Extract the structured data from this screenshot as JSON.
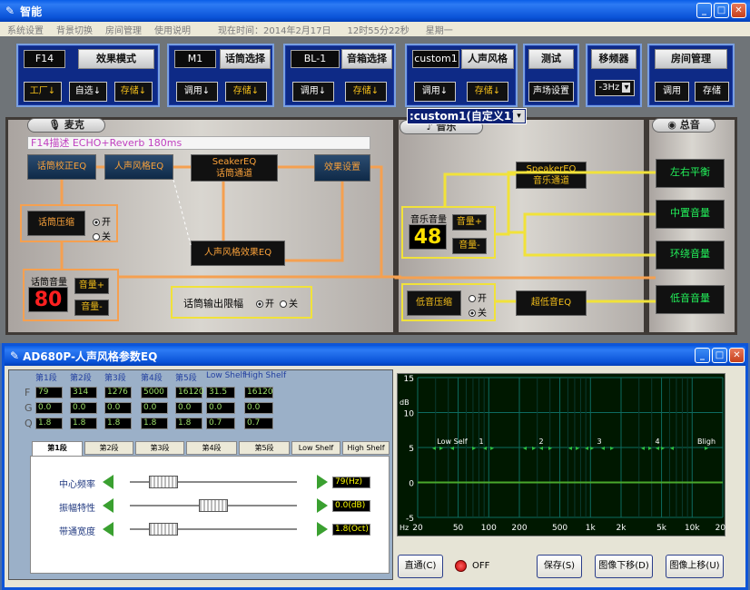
{
  "window": {
    "title": "智能"
  },
  "menu": [
    "系统设置",
    "背景切换",
    "房间管理",
    "使用说明",
    "现在时间：2014年2月17日",
    "12时55分22秒",
    "星期一"
  ],
  "top": {
    "effect": {
      "lcd": "F14",
      "label": "效果模式",
      "b1": "工厂↓",
      "b2": "自选↓",
      "b3": "存储↓"
    },
    "mic": {
      "lcd": "M1",
      "label": "话筒选择",
      "b1": "调用↓",
      "b2": "存储↓"
    },
    "spk": {
      "lcd": "BL-1",
      "label": "音箱选择",
      "b1": "调用↓",
      "b2": "存储↓"
    },
    "voice": {
      "lcd": "custom1",
      "label": "人声风格",
      "b1": "调用↓",
      "b2": "存储↓"
    },
    "test": {
      "label": "测试",
      "b1": "声场设置"
    },
    "shift": {
      "label": "移频器",
      "select": "-3Hz"
    },
    "room": {
      "label": "房间管理",
      "b1": "调用",
      "b2": "存储"
    },
    "dropdown": ":custom1(自定义1)"
  },
  "mic": {
    "title": "麦克",
    "desc": "F14描述  ECHO+Reverb 180ms",
    "eq": "话筒校正EQ",
    "style": "人声风格EQ",
    "seaker": "SeakerEQ",
    "seaker2": "话筒通道",
    "effset": "效果设置",
    "comp": "话筒压缩",
    "on": "开",
    "off": "关",
    "styleeff": "人声风格效果EQ",
    "vol_label": "话筒音量",
    "vol": "80",
    "up": "音量+",
    "dn": "音量-",
    "limit": "话筒输出限幅",
    "lon": "开",
    "loff": "关"
  },
  "music": {
    "title": "音乐",
    "speq": "SpeakerEQ",
    "speq2": "音乐通道",
    "vol_label": "音乐音量",
    "vol": "48",
    "up": "音量+",
    "dn": "音量-",
    "comp": "低音压缩",
    "on": "开",
    "off": "关",
    "sub": "超低音EQ"
  },
  "master": {
    "title": "总音",
    "b1": "左右平衡",
    "b2": "中置音量",
    "b3": "环绕音量",
    "b4": "低音音量"
  },
  "dlg": {
    "title": "AD680P-人声风格参数EQ",
    "headers": [
      "第1段",
      "第2段",
      "第3段",
      "第4段",
      "第5段",
      "Low Shelf",
      "High Shelf"
    ],
    "rowlabels": [
      "F",
      "G",
      "Q"
    ],
    "F": [
      "79",
      "314",
      "1276",
      "5000",
      "16120",
      "31.5",
      "16120"
    ],
    "G": [
      "0.0",
      "0.0",
      "0.0",
      "0.0",
      "0.0",
      "0.0",
      "0.0"
    ],
    "Q": [
      "1.8",
      "1.8",
      "1.8",
      "1.8",
      "1.8",
      "0.7",
      "0.7"
    ],
    "tabs": [
      "第1段",
      "第2段",
      "第3段",
      "第4段",
      "第5段",
      "Low Shelf",
      "High Shelf"
    ],
    "sliders": [
      {
        "label": "中心频率",
        "value": "79(Hz)",
        "pos": 0.2
      },
      {
        "label": "振幅特性",
        "value": "0.0(dB)",
        "pos": 0.5
      },
      {
        "label": "带通宽度",
        "value": "1.8(Oct)",
        "pos": 0.2
      }
    ],
    "buttons": {
      "bypass": "直通(C)",
      "off": "OFF",
      "save": "保存(S)",
      "down": "图像下移(D)",
      "up": "图像上移(U)"
    }
  },
  "chart_data": {
    "type": "line",
    "ylabel": "dB",
    "xlabel": "Hz",
    "y_ticks": [
      "15",
      "10",
      "5",
      "0",
      "-5"
    ],
    "x_ticks": [
      "20",
      "50",
      "100",
      "200",
      "500",
      "1k",
      "2k",
      "5k",
      "10k",
      "20k"
    ],
    "ylim": [
      -5,
      15
    ],
    "series": [
      {
        "values": [
          0,
          0,
          0,
          0,
          0,
          0,
          0,
          0,
          0,
          0
        ]
      }
    ],
    "markers": [
      "Low Self",
      "1",
      "2",
      "3",
      "4",
      "Bligh"
    ],
    "colors": {
      "bg": "#001800",
      "grid": "#0d6b60",
      "line": "#4aa82c",
      "text": "#ffffff"
    }
  }
}
